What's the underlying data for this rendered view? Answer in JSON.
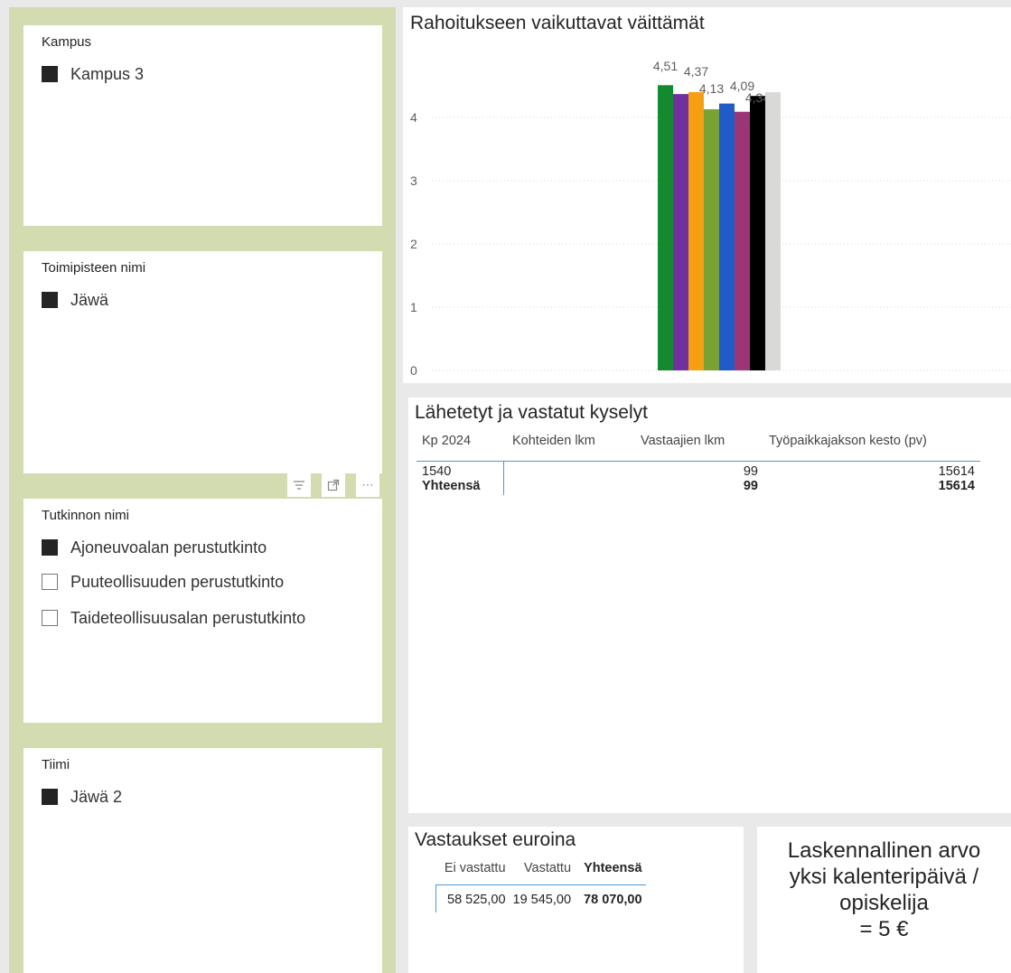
{
  "slicers": {
    "kampus": {
      "title": "Kampus",
      "items": [
        {
          "label": "Kampus 3",
          "checked": true
        }
      ]
    },
    "toimipiste": {
      "title": "Toimipisteen nimi",
      "items": [
        {
          "label": "Jäwä",
          "checked": true
        }
      ]
    },
    "tutkinto": {
      "title": "Tutkinnon nimi",
      "items": [
        {
          "label": "Ajoneuvoalan perustutkinto",
          "checked": true
        },
        {
          "label": "Puuteollisuuden perustutkinto",
          "checked": false
        },
        {
          "label": "Taideteollisuusalan perustutkinto",
          "checked": false
        }
      ]
    },
    "tiimi": {
      "title": "Tiimi",
      "items": [
        {
          "label": "Jäwä 2",
          "checked": true
        }
      ]
    }
  },
  "visual_toolbar": {
    "icons": [
      "filter-icon",
      "focus-mode-icon",
      "more-options-icon"
    ]
  },
  "chart": {
    "title": "Rahoitukseen vaikuttavat väittämät"
  },
  "chart_data": {
    "type": "bar",
    "title": "Rahoitukseen vaikuttavat väittämät",
    "xlabel": "",
    "ylabel": "",
    "ylim": [
      0,
      4.9
    ],
    "yticks": [
      "0",
      "1",
      "2",
      "3",
      "4"
    ],
    "grid": true,
    "legend": "none",
    "series": [
      {
        "value": 4.51,
        "label": "4,51",
        "color": "#138a2d"
      },
      {
        "value": 4.37,
        "label": "",
        "color": "#7030a0"
      },
      {
        "value": 4.4,
        "label": "4,37",
        "color": "#f79f13"
      },
      {
        "value": 4.13,
        "label": "4,13",
        "color": "#7aa233"
      },
      {
        "value": 4.22,
        "label": "",
        "color": "#1f5cc8"
      },
      {
        "value": 4.09,
        "label": "4,09",
        "color": "#9b3578"
      },
      {
        "value": 4.34,
        "label": "4,34",
        "color": "#000000"
      },
      {
        "value": 4.4,
        "label": "",
        "color": "#d9d9d5"
      }
    ]
  },
  "kyselyt": {
    "title": "Lähetetyt ja vastatut kyselyt",
    "headers": [
      "Kp 2024",
      "Kohteiden lkm",
      "Vastaajien lkm",
      "Työpaikkajakson kesto (pv)"
    ],
    "rows": [
      [
        "1540",
        "",
        "99",
        "15614"
      ]
    ],
    "total": [
      "Yhteensä",
      "",
      "99",
      "15614"
    ]
  },
  "euroina": {
    "title": "Vastaukset euroina",
    "headers": [
      "Ei vastattu",
      "Vastattu",
      "Yhteensä"
    ],
    "values": [
      "58 525,00",
      "19 545,00",
      "78 070,00"
    ]
  },
  "kpi": {
    "line1": "Laskennallinen arvo",
    "line2": "yksi kalenteripäivä /",
    "line3": "opiskelija",
    "line4": "= 5 €"
  }
}
